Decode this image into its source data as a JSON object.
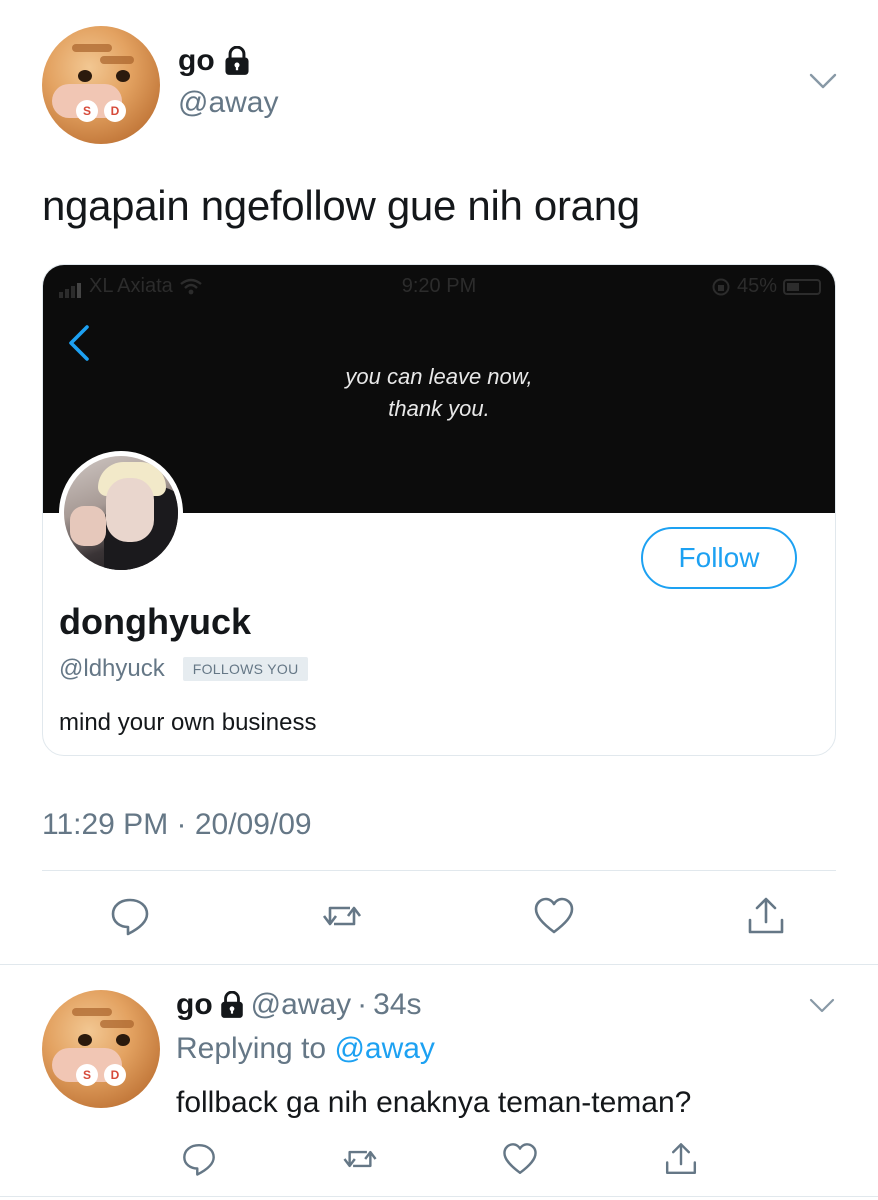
{
  "tweet": {
    "author_name": "go",
    "author_handle": "@away",
    "text": "ngapain ngefollow gue nih orang",
    "timestamp": "11:29 PM · 20/09/09"
  },
  "avatar_badge": {
    "left": "S",
    "right": "D"
  },
  "embed": {
    "statusbar": {
      "carrier": "XL Axiata",
      "time": "9:20 PM",
      "battery": "45%"
    },
    "banner_line1": "you can leave now,",
    "banner_line2": "thank you.",
    "profile": {
      "name": "donghyuck",
      "handle": "@ldhyuck",
      "follows_you": "FOLLOWS YOU",
      "bio": "mind your own business",
      "follow_label": "Follow"
    }
  },
  "reply": {
    "author_name": "go",
    "author_handle": "@away",
    "separator": "·",
    "time": "34s",
    "replying_prefix": "Replying to",
    "replying_to": "@away",
    "text": "follback ga nih enaknya teman-teman?"
  },
  "colors": {
    "accent": "#1da1f2",
    "secondary_text": "#657786",
    "divider": "#e1e8ed"
  }
}
